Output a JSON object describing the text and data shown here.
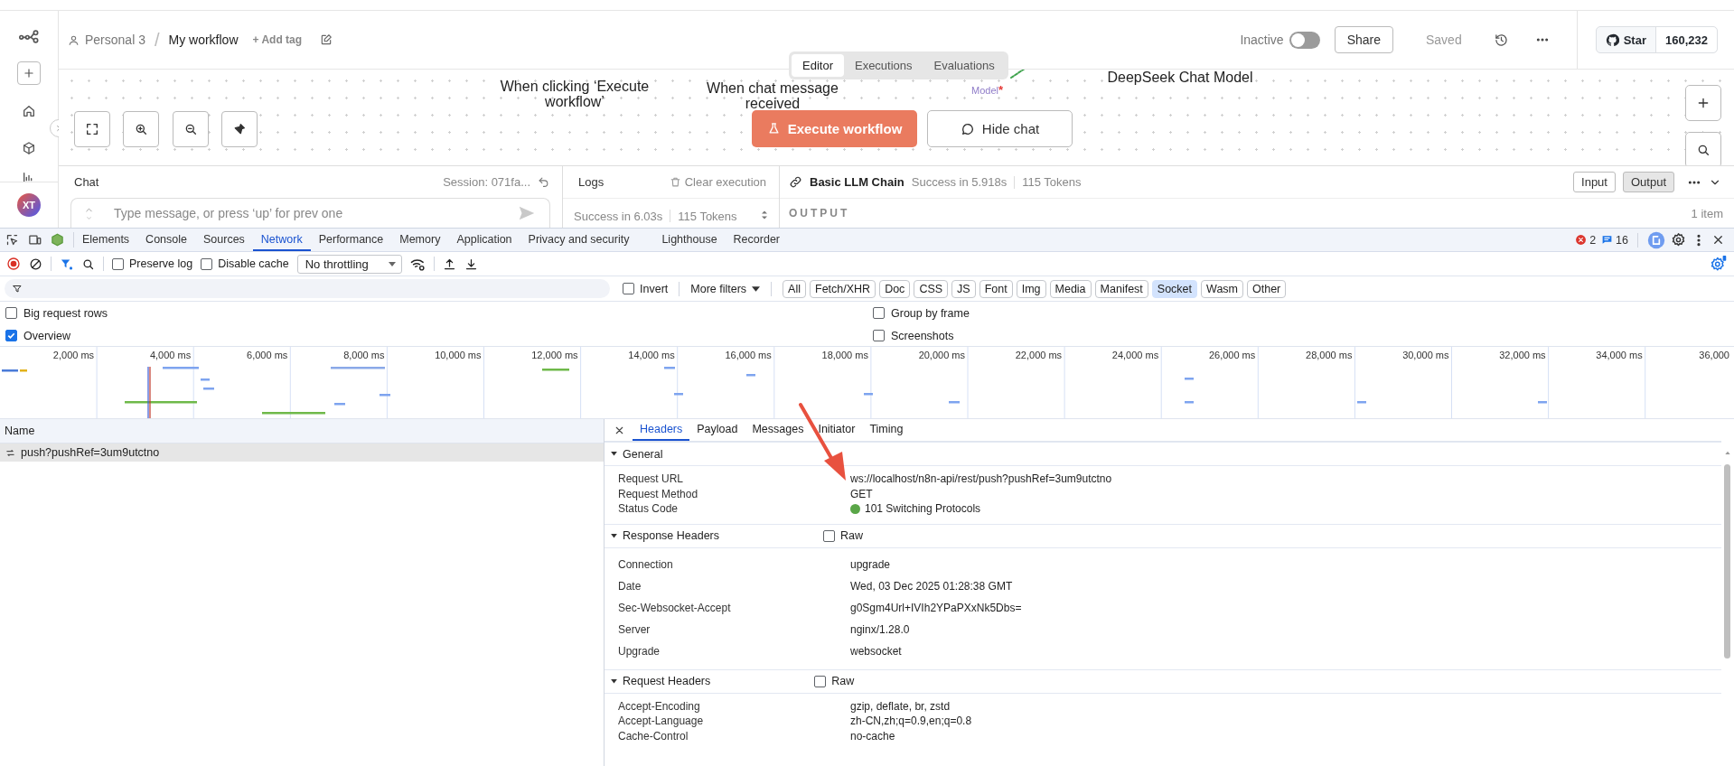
{
  "sidebar": {
    "avatar": "XT"
  },
  "header": {
    "breadcrumb": {
      "project": "Personal 3",
      "separator": "/",
      "workflow": "My workflow"
    },
    "add_tag": "+ Add tag",
    "status_label": "Inactive",
    "active": false,
    "share": "Share",
    "saved": "Saved",
    "github": {
      "label": "Star",
      "count": "160,232"
    }
  },
  "view_tabs": [
    {
      "label": "Editor",
      "selected": true
    },
    {
      "label": "Executions",
      "selected": false
    },
    {
      "label": "Evaluations",
      "selected": false
    }
  ],
  "canvas": {
    "nodes": [
      {
        "label": "When clicking ‘Execute workflow’"
      },
      {
        "label": "When chat message received"
      },
      {
        "label": "DeepSeek Chat Model"
      }
    ],
    "port_label": "Model",
    "port_required_mark": "*",
    "execute_button": "Execute workflow",
    "chat_button": "Hide chat"
  },
  "chat": {
    "title": "Chat",
    "session": "Session: 071fa...",
    "placeholder": "Type message, or press ‘up’ for prev one"
  },
  "logs": {
    "title": "Logs",
    "clear": "Clear execution",
    "status": "Success in 6.03s",
    "tokens": "115 Tokens"
  },
  "node_output": {
    "title": "Basic LLM Chain",
    "status": "Success in 5.918s",
    "tokens": "115 Tokens",
    "modes": [
      {
        "label": "Input",
        "selected": false
      },
      {
        "label": "Output",
        "selected": true
      }
    ],
    "section": "OUTPUT",
    "count": "1 item"
  },
  "devtools": {
    "tabs": [
      {
        "label": "Elements",
        "selected": false
      },
      {
        "label": "Console",
        "selected": false
      },
      {
        "label": "Sources",
        "selected": false
      },
      {
        "label": "Network",
        "selected": true
      },
      {
        "label": "Performance",
        "selected": false
      },
      {
        "label": "Memory",
        "selected": false
      },
      {
        "label": "Application",
        "selected": false
      },
      {
        "label": "Privacy and security",
        "selected": false
      },
      {
        "label": "Lighthouse",
        "selected": false
      },
      {
        "label": "Recorder",
        "selected": false
      }
    ],
    "errors": "2",
    "messages": "16",
    "toolbar": {
      "preserve_log": {
        "label": "Preserve log",
        "checked": false
      },
      "disable_cache": {
        "label": "Disable cache",
        "checked": false
      },
      "throttling": "No throttling"
    },
    "filter": {
      "invert": {
        "label": "Invert",
        "checked": false
      },
      "more_filters": "More filters",
      "types": [
        {
          "label": "All",
          "selected": false
        },
        {
          "label": "Fetch/XHR",
          "selected": false
        },
        {
          "label": "Doc",
          "selected": false
        },
        {
          "label": "CSS",
          "selected": false
        },
        {
          "label": "JS",
          "selected": false
        },
        {
          "label": "Font",
          "selected": false
        },
        {
          "label": "Img",
          "selected": false
        },
        {
          "label": "Media",
          "selected": false
        },
        {
          "label": "Manifest",
          "selected": false
        },
        {
          "label": "Socket",
          "selected": true
        },
        {
          "label": "Wasm",
          "selected": false
        },
        {
          "label": "Other",
          "selected": false
        }
      ]
    },
    "options": [
      {
        "label": "Big request rows",
        "checked": false
      },
      {
        "label": "Group by frame",
        "checked": false
      },
      {
        "label": "Overview",
        "checked": true
      },
      {
        "label": "Screenshots",
        "checked": false
      }
    ],
    "overview": {
      "ticks": [
        "2,000 ms",
        "4,000 ms",
        "6,000 ms",
        "8,000 ms",
        "10,000 ms",
        "12,000 ms",
        "14,000 ms",
        "16,000 ms",
        "18,000 ms",
        "20,000 ms",
        "22,000 ms",
        "24,000 ms",
        "26,000 ms",
        "28,000 ms",
        "30,000 ms",
        "32,000 ms",
        "34,000 ms",
        "36,000"
      ]
    },
    "requests": {
      "column": "Name",
      "rows": [
        {
          "name": "push?pushRef=3um9utctno",
          "selected": true
        }
      ]
    },
    "details": {
      "tabs": [
        {
          "label": "Headers",
          "selected": true
        },
        {
          "label": "Payload",
          "selected": false
        },
        {
          "label": "Messages",
          "selected": false
        },
        {
          "label": "Initiator",
          "selected": false
        },
        {
          "label": "Timing",
          "selected": false
        }
      ],
      "sections": [
        {
          "title": "General",
          "expanded": true,
          "rows": [
            {
              "name": "Request URL",
              "value": "ws://localhost/n8n-api/rest/push?pushRef=3um9utctno"
            },
            {
              "name": "Request Method",
              "value": "GET"
            },
            {
              "name": "Status Code",
              "value": "101 Switching Protocols",
              "color": "#5aa648"
            }
          ]
        },
        {
          "title": "Response Headers",
          "expanded": true,
          "raw": {
            "label": "Raw",
            "checked": false
          },
          "rows": [
            {
              "name": "Connection",
              "value": "upgrade"
            },
            {
              "name": "Date",
              "value": "Wed, 03 Dec 2025 01:28:38 GMT"
            },
            {
              "name": "Sec-Websocket-Accept",
              "value": "g0Sgm4Url+IVIh2YPaPXxNk5Dbs="
            },
            {
              "name": "Server",
              "value": "nginx/1.28.0"
            },
            {
              "name": "Upgrade",
              "value": "websocket"
            }
          ]
        },
        {
          "title": "Request Headers",
          "expanded": true,
          "raw": {
            "label": "Raw",
            "checked": false
          },
          "rows": [
            {
              "name": "Accept-Encoding",
              "value": "gzip, deflate, br, zstd"
            },
            {
              "name": "Accept-Language",
              "value": "zh-CN,zh;q=0.9,en;q=0.8"
            },
            {
              "name": "Cache-Control",
              "value": "no-cache"
            }
          ]
        }
      ]
    }
  }
}
